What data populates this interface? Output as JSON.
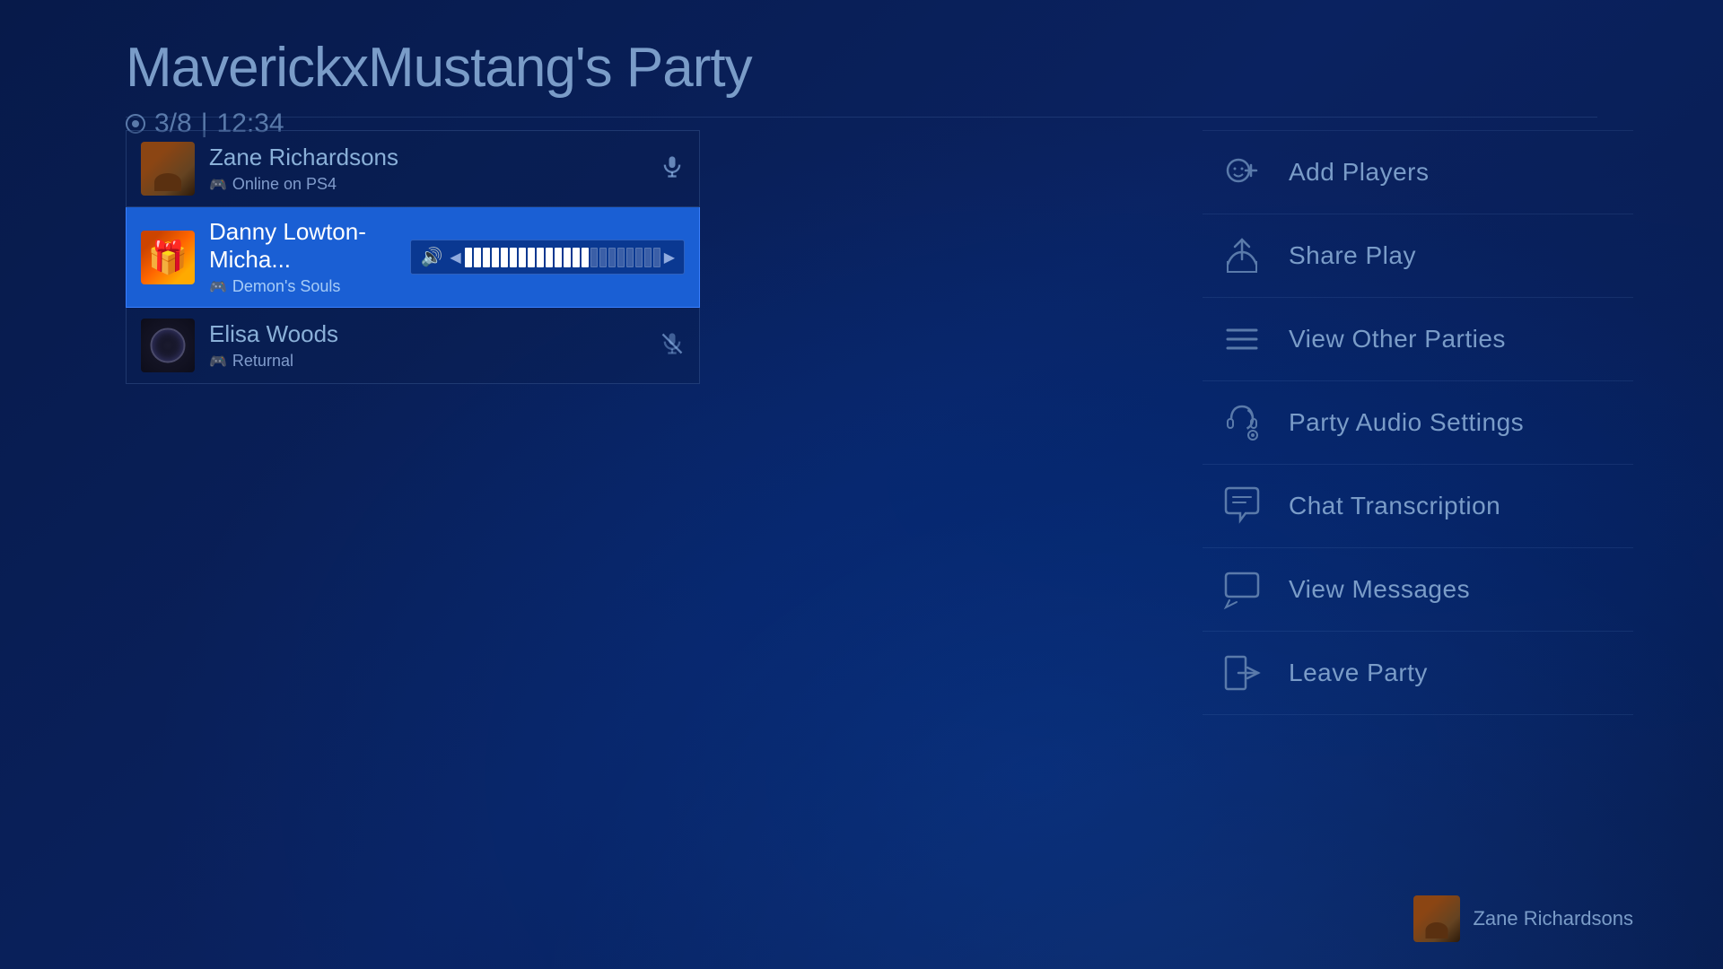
{
  "header": {
    "title": "MaverickxMustang's Party",
    "member_count": "3/8",
    "time": "12:34"
  },
  "players": [
    {
      "id": "zane",
      "name": "Zane Richardsons",
      "status": "Online on PS4",
      "status_icon": "controller",
      "active": false,
      "muted": false,
      "avatar_class": "zane"
    },
    {
      "id": "danny",
      "name": "Danny Lowton-Micha...",
      "status": "Demon's Souls",
      "status_icon": "controller",
      "active": true,
      "muted": false,
      "avatar_class": "danny",
      "volume": 14,
      "volume_max": 22
    },
    {
      "id": "elisa",
      "name": "Elisa Woods",
      "status": "Returnal",
      "status_icon": "controller",
      "active": false,
      "muted": true,
      "avatar_class": "elisa"
    }
  ],
  "menu": {
    "items": [
      {
        "id": "add-players",
        "label": "Add Players",
        "icon": "add-player-icon"
      },
      {
        "id": "share-play",
        "label": "Share Play",
        "icon": "share-play-icon"
      },
      {
        "id": "view-other-parties",
        "label": "View Other Parties",
        "icon": "parties-icon"
      },
      {
        "id": "party-audio-settings",
        "label": "Party Audio Settings",
        "icon": "audio-icon"
      },
      {
        "id": "chat-transcription",
        "label": "Chat Transcription",
        "icon": "transcription-icon"
      },
      {
        "id": "view-messages",
        "label": "View Messages",
        "icon": "messages-icon"
      },
      {
        "id": "leave-party",
        "label": "Leave Party",
        "icon": "leave-icon"
      }
    ]
  },
  "bottom_user": {
    "username": "Zane Richardsons",
    "avatar_class": "zane"
  }
}
